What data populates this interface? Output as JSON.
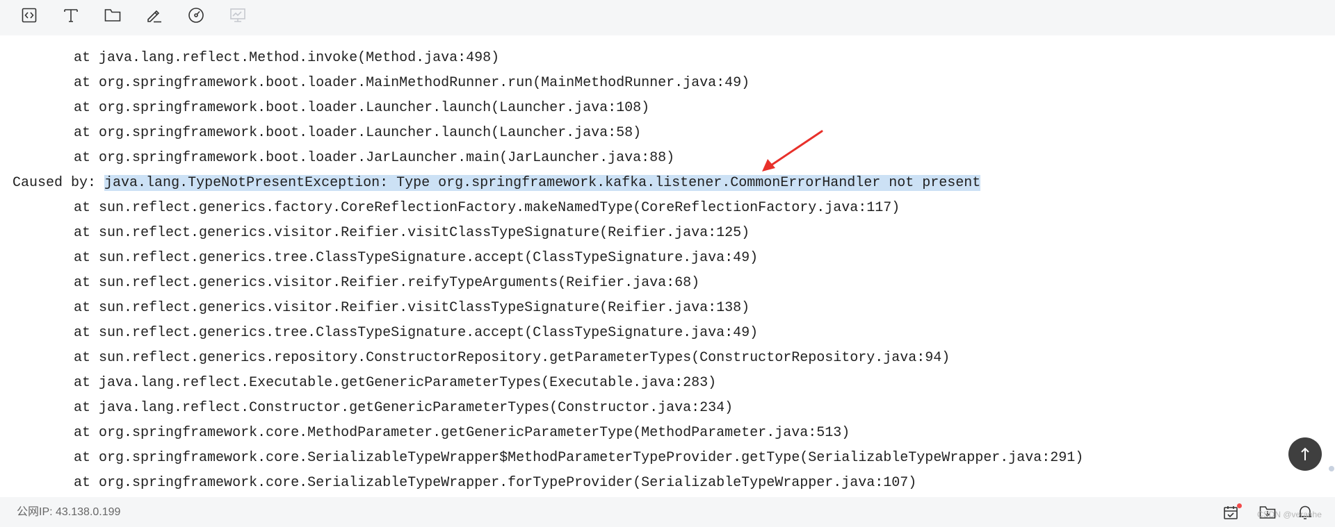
{
  "toolbar": {
    "icons": [
      "code-icon",
      "text-icon",
      "folder-icon",
      "edit-icon",
      "dashboard-icon",
      "monitor-icon"
    ]
  },
  "console": {
    "lines": [
      {
        "prefix": "at",
        "text": "java.lang.reflect.Method.invoke(Method.java:498)"
      },
      {
        "prefix": "at",
        "text": "org.springframework.boot.loader.MainMethodRunner.run(MainMethodRunner.java:49)"
      },
      {
        "prefix": "at",
        "text": "org.springframework.boot.loader.Launcher.launch(Launcher.java:108)"
      },
      {
        "prefix": "at",
        "text": "org.springframework.boot.loader.Launcher.launch(Launcher.java:58)"
      },
      {
        "prefix": "at",
        "text": "org.springframework.boot.loader.JarLauncher.main(JarLauncher.java:88)"
      },
      {
        "prefix": "Caused by:",
        "text": "java.lang.TypeNotPresentException: Type org.springframework.kafka.listener.CommonErrorHandler not present",
        "highlighted": true
      },
      {
        "prefix": "at",
        "text": "sun.reflect.generics.factory.CoreReflectionFactory.makeNamedType(CoreReflectionFactory.java:117)"
      },
      {
        "prefix": "at",
        "text": "sun.reflect.generics.visitor.Reifier.visitClassTypeSignature(Reifier.java:125)"
      },
      {
        "prefix": "at",
        "text": "sun.reflect.generics.tree.ClassTypeSignature.accept(ClassTypeSignature.java:49)"
      },
      {
        "prefix": "at",
        "text": "sun.reflect.generics.visitor.Reifier.reifyTypeArguments(Reifier.java:68)"
      },
      {
        "prefix": "at",
        "text": "sun.reflect.generics.visitor.Reifier.visitClassTypeSignature(Reifier.java:138)"
      },
      {
        "prefix": "at",
        "text": "sun.reflect.generics.tree.ClassTypeSignature.accept(ClassTypeSignature.java:49)"
      },
      {
        "prefix": "at",
        "text": "sun.reflect.generics.repository.ConstructorRepository.getParameterTypes(ConstructorRepository.java:94)"
      },
      {
        "prefix": "at",
        "text": "java.lang.reflect.Executable.getGenericParameterTypes(Executable.java:283)"
      },
      {
        "prefix": "at",
        "text": "java.lang.reflect.Constructor.getGenericParameterTypes(Constructor.java:234)"
      },
      {
        "prefix": "at",
        "text": "org.springframework.core.MethodParameter.getGenericParameterType(MethodParameter.java:513)"
      },
      {
        "prefix": "at",
        "text": "org.springframework.core.SerializableTypeWrapper$MethodParameterTypeProvider.getType(SerializableTypeWrapper.java:291)"
      },
      {
        "prefix": "at",
        "text": "org.springframework.core.SerializableTypeWrapper.forTypeProvider(SerializableTypeWrapper.java:107)"
      }
    ],
    "highlight_color": "#cce1f5",
    "arrow_color": "#e8302a"
  },
  "statusbar": {
    "ip_text": "公网IP: 43.138.0.199",
    "watermark": "CSDN @veranhe",
    "icons": [
      "calendar-check-icon",
      "folder-download-icon",
      "bell-icon"
    ],
    "notification_dot_color": "#f24b4b"
  }
}
